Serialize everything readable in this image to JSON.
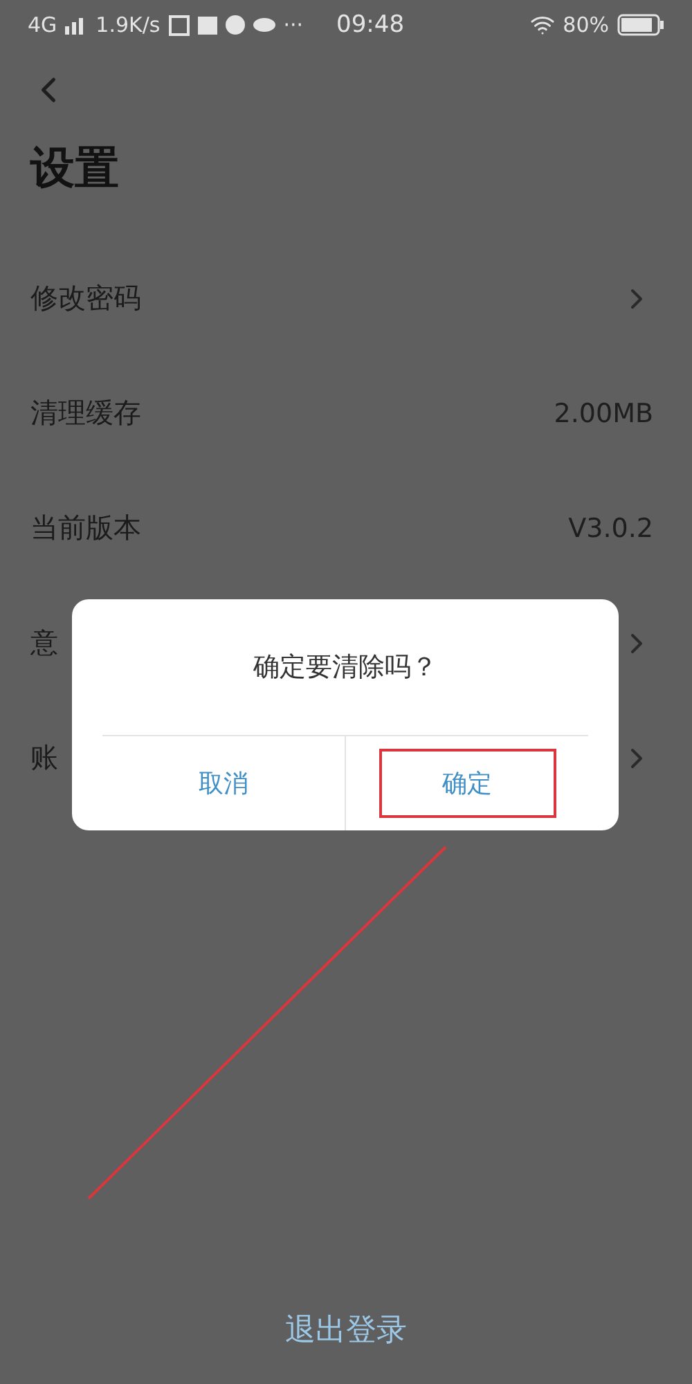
{
  "status_bar": {
    "network": "4G",
    "speed": "1.9K/s",
    "more": "···",
    "time": "09:48",
    "battery": "80%"
  },
  "title": "设置",
  "rows": [
    {
      "label": "修改密码",
      "kind": "link"
    },
    {
      "label": "清理缓存",
      "kind": "value",
      "value": "2.00MB"
    },
    {
      "label": "当前版本",
      "kind": "value",
      "value": "V3.0.2"
    },
    {
      "label": "意",
      "kind": "link"
    },
    {
      "label": "账",
      "kind": "link"
    }
  ],
  "dialog": {
    "message": "确定要清除吗？",
    "buttons": [
      {
        "label": "取消",
        "highlighted": false
      },
      {
        "label": "确定",
        "highlighted": true
      }
    ]
  },
  "logout": "退出登录"
}
